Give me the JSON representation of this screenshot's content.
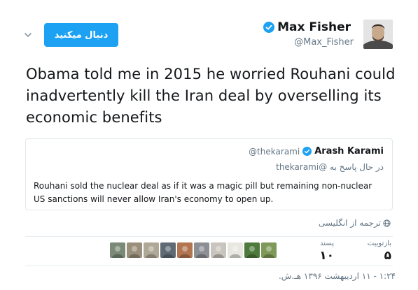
{
  "header": {
    "follow_label": "دنبال میکنید",
    "author_name": "Max Fisher",
    "author_handle": "@Max_Fisher"
  },
  "tweet": {
    "text": "Obama told me in 2015 he worried Rouhani could inadvertently kill the Iran deal by overselling its economic benefits"
  },
  "quote": {
    "name": "Arash Karami",
    "handle": "@thekarami",
    "reply_prefix": "در حال پاسخ به",
    "reply_to": "@thekarami",
    "text": "Rouhani sold the nuclear deal as if it was a magic pill but remaining non-nuclear US sanctions will never allow Iran's economy to open up."
  },
  "translate_label": "ترجمه از انگلیسی",
  "stats": {
    "retweets_label": "بازتوییت",
    "retweets_value": "۵",
    "likes_label": "پسند",
    "likes_value": "۱۰"
  },
  "likers": [
    {
      "icon": "liker-avatar",
      "color": "#7a8a76"
    },
    {
      "icon": "liker-avatar",
      "color": "#9a8f7a"
    },
    {
      "icon": "liker-avatar",
      "color": "#b0a896"
    },
    {
      "icon": "liker-avatar",
      "color": "#5f6a74"
    },
    {
      "icon": "liker-avatar",
      "color": "#b2754f"
    },
    {
      "icon": "liker-avatar",
      "color": "#8c8f93"
    },
    {
      "icon": "liker-avatar",
      "color": "#c9c4bd"
    },
    {
      "icon": "liker-avatar",
      "color": "#e8e8e0"
    },
    {
      "icon": "liker-avatar",
      "color": "#4f7a3e"
    },
    {
      "icon": "liker-avatar",
      "color": "#7f9a58"
    }
  ],
  "timestamp": "۱:۲۴ - ۱۱ اردیبهشت ۱۳۹۶ هـ.ش.",
  "colors": {
    "accent": "#1da1f2",
    "text": "#14171a",
    "muted": "#657786",
    "border": "#e1e8ed"
  }
}
